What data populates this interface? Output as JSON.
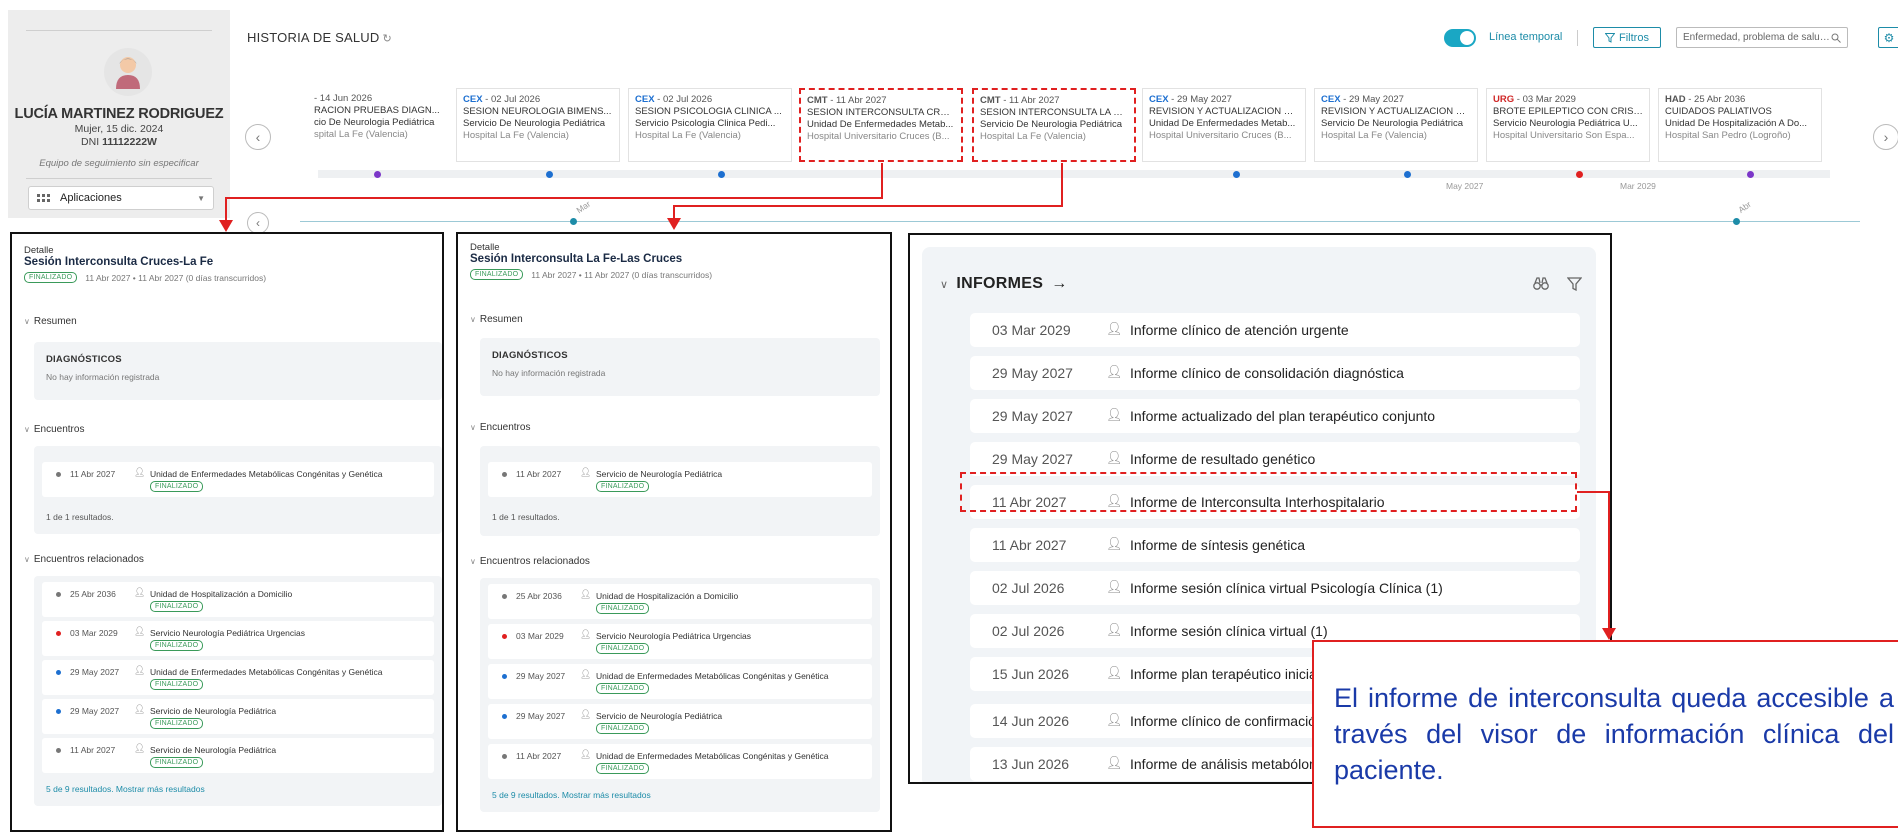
{
  "patient": {
    "name": "LUCÍA MARTINEZ RODRIGUEZ",
    "sub": "Mujer, 15 dic. 2024",
    "dni_label": "DNI",
    "dni": "11112222W",
    "team": "Equipo de seguimiento sin especificar",
    "apps_label": "Aplicaciones"
  },
  "header": {
    "title": "HISTORIA DE SALUD",
    "timeline_label": "Línea temporal",
    "timeline_on": true,
    "filters_label": "Filtros",
    "search_placeholder": "Enfermedad, problema de salud..."
  },
  "timeline": {
    "cards": [
      {
        "type": "",
        "date": "- 14 Jun 2026",
        "title": "RACION PRUEBAS DIAGN...",
        "service": "cio De Neurologia Pediátrica",
        "hospital": "spital La Fe (Valencia)",
        "type_color": "#555555"
      },
      {
        "type": "CEX",
        "date": " - 02 Jul 2026",
        "title": "SESION NEUROLOGIA BIMENS...",
        "service": "Servicio De Neurologia Pediátrica",
        "hospital": "Hospital La Fe (Valencia)",
        "type_color": "#1d6fd0"
      },
      {
        "type": "CEX",
        "date": " - 02 Jul 2026",
        "title": "SESION PSICOLOGIA CLINICA ...",
        "service": "Servicio Psicologia Clinica Pedi...",
        "hospital": "Hospital La Fe (Valencia)",
        "type_color": "#1d6fd0"
      },
      {
        "type": "CMT",
        "date": " - 11 Abr 2027",
        "title": "SESION INTERCONSULTA CRUC...",
        "service": "Unidad De Enfermedades Metab...",
        "hospital": "Hospital Universitario Cruces (B...",
        "type_color": "#555555"
      },
      {
        "type": "CMT",
        "date": " - 11 Abr 2027",
        "title": "SESION INTERCONSULTA LA FE...",
        "service": "Servicio De Neurologia Pediátrica",
        "hospital": "Hospital La Fe (Valencia)",
        "type_color": "#555555"
      },
      {
        "type": "CEX",
        "date": " - 29 May 2027",
        "title": "REVISION Y ACTUALIZACION EL...",
        "service": "Unidad De Enfermedades Metab...",
        "hospital": "Hospital Universitario Cruces (B...",
        "type_color": "#1d6fd0"
      },
      {
        "type": "CEX",
        "date": " - 29 May 2027",
        "title": "REVISION Y ACTUALIZACION EL...",
        "service": "Servicio De Neurologia Pediátrica",
        "hospital": "Hospital La Fe (Valencia)",
        "type_color": "#1d6fd0"
      },
      {
        "type": "URG",
        "date": " - 03 Mar 2029",
        "title": "BROTE EPILEPTICO CON CRISIS...",
        "service": "Servicio Neurologia Pediátrica U...",
        "hospital": "Hospital Universitario Son Espa...",
        "type_color": "#d02828"
      },
      {
        "type": "HAD",
        "date": " - 25 Abr 2036",
        "title": "CUIDADOS PALIATIVOS",
        "service": "Unidad De Hospitalización A Do...",
        "hospital": "Hospital San Pedro (Logroño)",
        "type_color": "#555555"
      }
    ],
    "months": [
      "May 2027",
      "Mar 2029"
    ],
    "axis_labels": [
      "Mar",
      "Abr"
    ]
  },
  "detail_1": {
    "label": "Detalle",
    "title": "Sesión Interconsulta Cruces-La Fe",
    "status": "FINALIZADO",
    "dates": "11 Abr 2027 • 11 Abr 2027 (0 días transcurridos)",
    "resumen": "Resumen",
    "diagnosticos": "DIAGNÓSTICOS",
    "no_info": "No hay información registrada",
    "encuentros": "Encuentros",
    "enc": [
      {
        "date": "11 Abr 2027",
        "unit": "Unidad de Enfermedades Metabólicas Congénitas y Genética",
        "badge": "FINALIZADO",
        "dot": "#777777"
      }
    ],
    "enc_count": "1 de 1 resultados.",
    "relacionados": "Encuentros relacionados",
    "rel": [
      {
        "date": "25 Abr 2036",
        "unit": "Unidad de Hospitalización a Domicilio",
        "badge": "FINALIZADO",
        "dot": "#777777"
      },
      {
        "date": "03 Mar 2029",
        "unit": "Servicio Neurología Pediátrica Urgencias",
        "badge": "FINALIZADO",
        "dot": "#e02020"
      },
      {
        "date": "29 May 2027",
        "unit": "Unidad de Enfermedades Metabólicas Congénitas y Genética",
        "badge": "FINALIZADO",
        "dot": "#1d6fd0"
      },
      {
        "date": "29 May 2027",
        "unit": "Servicio de Neurología Pediátrica",
        "badge": "FINALIZADO",
        "dot": "#1d6fd0"
      },
      {
        "date": "11 Abr 2027",
        "unit": "Servicio de Neurología Pediátrica",
        "badge": "FINALIZADO",
        "dot": "#777777"
      }
    ],
    "more": "5 de 9 resultados. Mostrar más resultados"
  },
  "detail_2": {
    "label": "Detalle",
    "title": "Sesión Interconsulta La Fe-Las Cruces",
    "status": "FINALIZADO",
    "dates": "11 Abr 2027 • 11 Abr 2027 (0 días transcurridos)",
    "resumen": "Resumen",
    "diagnosticos": "DIAGNÓSTICOS",
    "no_info": "No hay información registrada",
    "encuentros": "Encuentros",
    "enc": [
      {
        "date": "11 Abr 2027",
        "unit": "Servicio de Neurología Pediátrica",
        "badge": "FINALIZADO",
        "dot": "#777777"
      }
    ],
    "enc_count": "1 de 1 resultados.",
    "relacionados": "Encuentros relacionados",
    "rel": [
      {
        "date": "25 Abr 2036",
        "unit": "Unidad de Hospitalización a Domicilio",
        "badge": "FINALIZADO",
        "dot": "#777777"
      },
      {
        "date": "03 Mar 2029",
        "unit": "Servicio Neurología Pediátrica Urgencias",
        "badge": "FINALIZADO",
        "dot": "#e02020"
      },
      {
        "date": "29 May 2027",
        "unit": "Unidad de Enfermedades Metabólicas Congénitas y Genética",
        "badge": "FINALIZADO",
        "dot": "#1d6fd0"
      },
      {
        "date": "29 May 2027",
        "unit": "Servicio de Neurología Pediátrica",
        "badge": "FINALIZADO",
        "dot": "#1d6fd0"
      },
      {
        "date": "11 Abr 2027",
        "unit": "Unidad de Enfermedades Metabólicas Congénitas y Genética",
        "badge": "FINALIZADO",
        "dot": "#777777"
      }
    ],
    "more": "5 de 9 resultados. Mostrar más resultados"
  },
  "informes": {
    "title": "INFORMES",
    "rows": [
      {
        "date": "03 Mar 2029",
        "name": "Informe clínico de atención urgente"
      },
      {
        "date": "29 May 2027",
        "name": "Informe clínico de consolidación diagnóstica"
      },
      {
        "date": "29 May 2027",
        "name": "Informe actualizado del plan terapéutico conjunto"
      },
      {
        "date": "29 May 2027",
        "name": "Informe de resultado genético"
      },
      {
        "date": "11 Abr 2027",
        "name": "Informe de Interconsulta Interhospitalario"
      },
      {
        "date": "11 Abr 2027",
        "name": "Informe de síntesis genética"
      },
      {
        "date": "02 Jul 2026",
        "name": "Informe sesión clínica virtual Psicología Clínica (1)"
      },
      {
        "date": "02 Jul 2026",
        "name": "Informe sesión clínica virtual (1)"
      },
      {
        "date": "15 Jun 2026",
        "name": "Informe plan terapéutico inicia"
      },
      {
        "date": "14 Jun 2026",
        "name": "Informe clínico de confirmació"
      },
      {
        "date": "13 Jun 2026",
        "name": "Informe de análisis metabólom"
      }
    ]
  },
  "callout": {
    "text": "El informe de interconsulta queda accesible a través del visor de información clínica del paciente."
  },
  "colors": {
    "accent": "#1d8ca8",
    "annotation_red": "#e02020",
    "annotation_text": "#1a3aa8"
  }
}
